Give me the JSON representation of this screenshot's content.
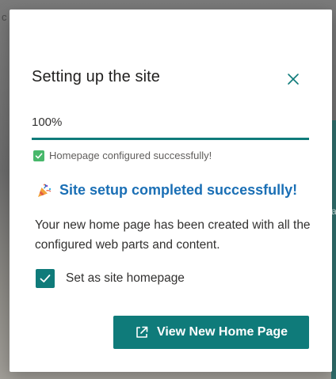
{
  "background": {
    "top_text": "c",
    "right_text": "a"
  },
  "dialog": {
    "title": "Setting up the site",
    "close_icon": "close-icon",
    "progress": {
      "value_text": "100%",
      "percent": 100
    },
    "status": {
      "icon": "check-mark-icon",
      "text": "Homepage configured successfully!"
    },
    "success": {
      "icon": "party-popper-icon",
      "heading": "Site setup completed successfully!"
    },
    "description": "Your new home page has been created with all the configured web parts and content.",
    "homepage_checkbox": {
      "label": "Set as site homepage",
      "checked": true
    },
    "primary_button": {
      "icon": "open-external-icon",
      "label": "View New Home Page"
    }
  },
  "colors": {
    "accent": "#0f7b7a",
    "link": "#1a6fb5",
    "success_check": "#48b86b"
  }
}
